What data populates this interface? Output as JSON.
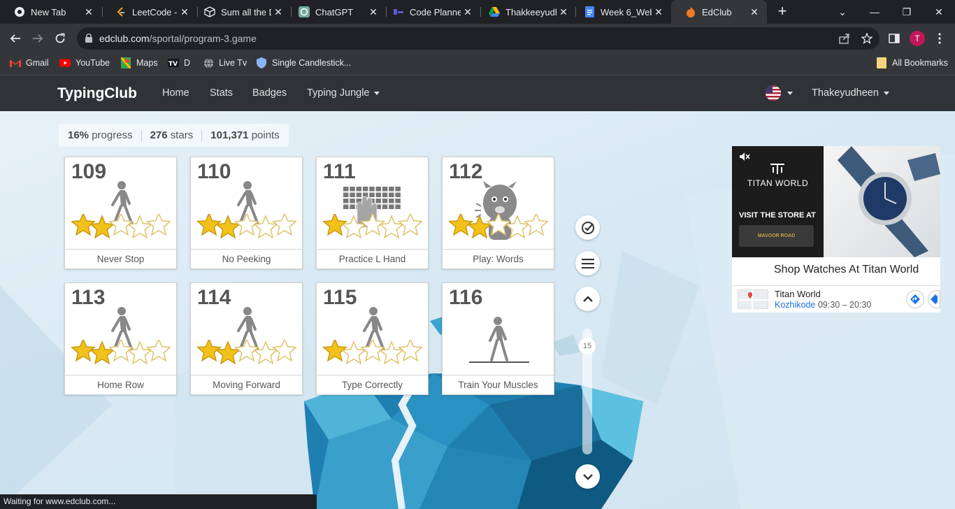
{
  "browser": {
    "tabs": [
      {
        "title": "New Tab",
        "icon": "chrome-icon"
      },
      {
        "title": "LeetCode - T",
        "icon": "leetcode-icon"
      },
      {
        "title": "Sum all the D",
        "icon": "cube-icon"
      },
      {
        "title": "ChatGPT",
        "icon": "chatgpt-icon"
      },
      {
        "title": "Code Planne",
        "icon": "codeplanner-icon"
      },
      {
        "title": "Thakkeeyudh",
        "icon": "google-drive-icon"
      },
      {
        "title": "Week 6_Web",
        "icon": "google-docs-icon"
      },
      {
        "title": "EdClub",
        "icon": "edclub-icon"
      }
    ],
    "url_host": "edclub.com",
    "url_path": "/sportal/program-3.game",
    "profile_initial": "T",
    "bookmarks": [
      {
        "label": "Gmail",
        "icon": "gmail-icon"
      },
      {
        "label": "YouTube",
        "icon": "youtube-icon"
      },
      {
        "label": "Maps",
        "icon": "maps-icon"
      },
      {
        "label": "D",
        "icon": "tradingview-icon"
      },
      {
        "label": "Live Tv",
        "icon": "globe-icon"
      },
      {
        "label": "Single Candlestick...",
        "icon": "shield-icon"
      }
    ],
    "all_bookmarks": "All Bookmarks",
    "status_text": "Waiting for www.edclub.com..."
  },
  "site": {
    "logo": "TypingClub",
    "nav": {
      "home": "Home",
      "stats": "Stats",
      "badges": "Badges",
      "jungle": "Typing Jungle"
    },
    "username": "Thakeyudheen"
  },
  "progress": {
    "percent": "16%",
    "percent_label": "progress",
    "stars": "276",
    "stars_label": "stars",
    "points": "101,371",
    "points_label": "points"
  },
  "lessons": [
    {
      "number": "109",
      "title": "Never Stop",
      "stars_earned": 2,
      "stars_total": 5,
      "art": "walker"
    },
    {
      "number": "110",
      "title": "No Peeking",
      "stars_earned": 2,
      "stars_total": 5,
      "art": "walker"
    },
    {
      "number": "111",
      "title": "Practice L Hand",
      "stars_earned": 1,
      "stars_total": 5,
      "art": "keyboard-hand"
    },
    {
      "number": "112",
      "title": "Play: Words",
      "stars_earned": 2,
      "stars_total": 5,
      "art": "monster"
    },
    {
      "number": "113",
      "title": "Home Row",
      "stars_earned": 2,
      "stars_total": 5,
      "art": "walker"
    },
    {
      "number": "114",
      "title": "Moving Forward",
      "stars_earned": 2,
      "stars_total": 5,
      "art": "walker"
    },
    {
      "number": "115",
      "title": "Type Correctly",
      "stars_earned": 1,
      "stars_total": 5,
      "art": "walker"
    },
    {
      "number": "116",
      "title": "Train Your Muscles",
      "stars_earned": 0,
      "stars_total": 0,
      "art": "walker-line"
    }
  ],
  "scroll_level": "15",
  "ad": {
    "brand": "TITAN WORLD",
    "visit": "VISIT THE STORE AT",
    "store_button": "MAVOOR ROAD",
    "headline": "Shop Watches At Titan World",
    "store_name": "Titan World",
    "city": "Kozhikode",
    "hours": "09:30 – 20:30"
  },
  "colors": {
    "star_gold": "#f2c21b",
    "navbar": "#2f3337",
    "accent_blue": "#1a73e8"
  }
}
